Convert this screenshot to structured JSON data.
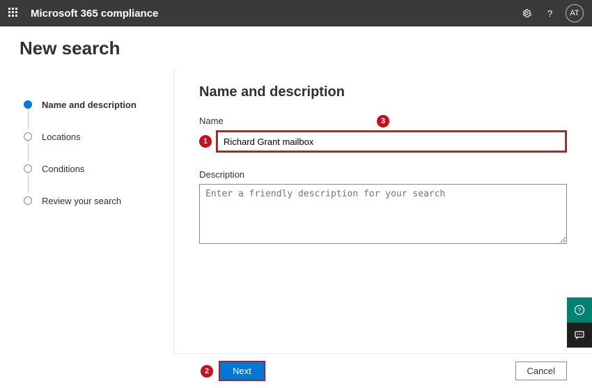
{
  "header": {
    "app_title": "Microsoft 365 compliance",
    "user_initials": "AT"
  },
  "page": {
    "title": "New search"
  },
  "wizard": {
    "steps": [
      {
        "label": "Name and description",
        "active": true
      },
      {
        "label": "Locations",
        "active": false
      },
      {
        "label": "Conditions",
        "active": false
      },
      {
        "label": "Review your search",
        "active": false
      }
    ]
  },
  "form": {
    "heading": "Name and description",
    "name_label": "Name",
    "name_value": "Richard Grant mailbox",
    "description_label": "Description",
    "description_placeholder": "Enter a friendly description for your search"
  },
  "footer": {
    "next_label": "Next",
    "cancel_label": "Cancel"
  },
  "annotations": {
    "a1": "1",
    "a2": "2",
    "a3": "3"
  }
}
